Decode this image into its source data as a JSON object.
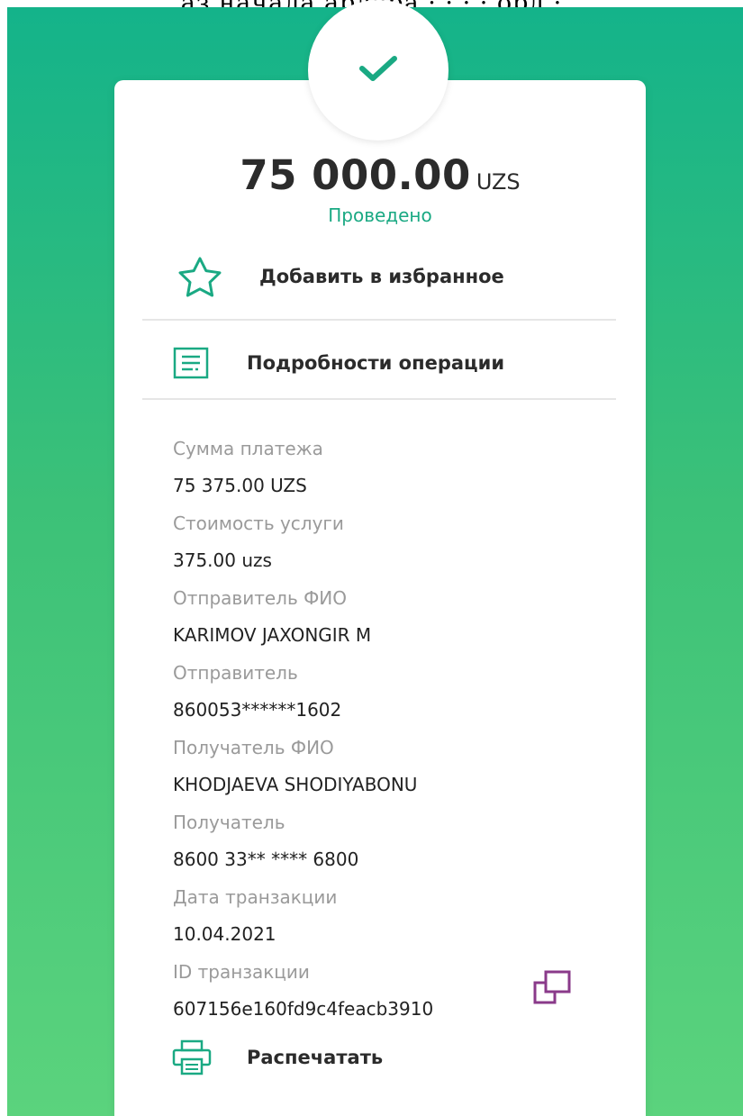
{
  "top_caption": "аз  начала ардора  ·  ·  ·  · орд ·",
  "receipt": {
    "amount": "75 000.00",
    "currency": "UZS",
    "status": "Проведено",
    "favorite_label": "Добавить в избранное",
    "details_label": "Подробности операции",
    "print_label": "Распечатать"
  },
  "fields": [
    {
      "label": "Сумма платежа",
      "value": "75 375.00 UZS"
    },
    {
      "label": "Стоимость услуги",
      "value": "375.00 uzs"
    },
    {
      "label": "Отправитель ФИО",
      "value": "KARIMOV JAXONGIR M"
    },
    {
      "label": "Отправитель",
      "value": "860053******1602"
    },
    {
      "label": "Получатель ФИО",
      "value": "KHODJAEVA SHODIYABONU"
    },
    {
      "label": "Получатель",
      "value": "8600 33** **** 6800"
    },
    {
      "label": "Дата транзакции",
      "value": "10.04.2021"
    },
    {
      "label": "ID транзакции",
      "value": "607156e160fd9c4feacb3910"
    }
  ],
  "icons": {
    "check": "check-icon",
    "favorite": "star-icon",
    "details": "document-list-icon",
    "copy": "copy-icon",
    "print": "printer-icon"
  },
  "colors": {
    "accent": "#1aa983",
    "copy_icon": "#8a3a8a",
    "background_top": "#14b38a",
    "background_bottom": "#5bd37d"
  }
}
